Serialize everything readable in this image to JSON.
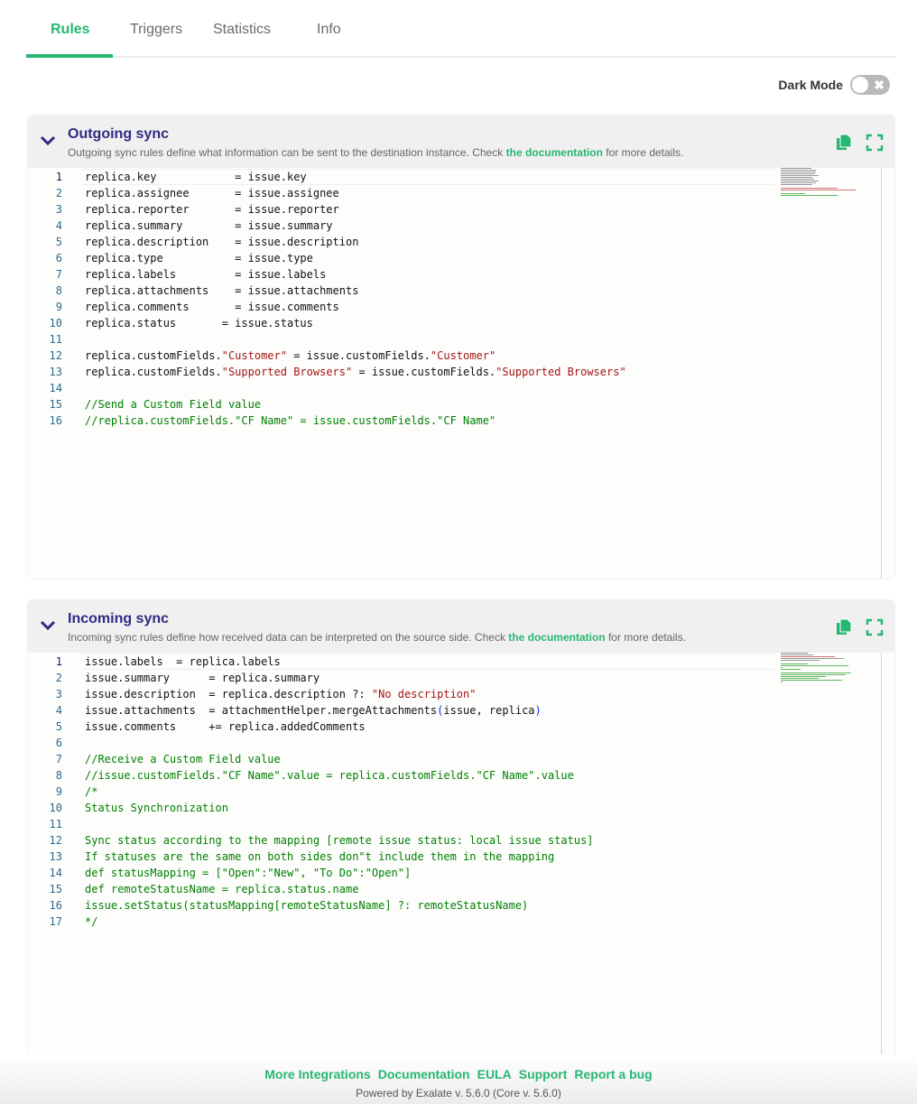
{
  "tabs": [
    {
      "label": "Rules",
      "active": true
    },
    {
      "label": "Triggers",
      "active": false
    },
    {
      "label": "Statistics",
      "active": false
    },
    {
      "label": "Info",
      "active": false
    }
  ],
  "dark_mode": {
    "label": "Dark Mode",
    "enabled": false
  },
  "colors": {
    "accent": "#27b772",
    "title": "#2f2b83",
    "string": "#a31515",
    "comment": "#008000"
  },
  "outgoing": {
    "title": "Outgoing sync",
    "desc_before": "Outgoing sync rules define what information can be sent to the destination instance. Check ",
    "desc_link": "the documentation",
    "desc_after": " for more details.",
    "lines": [
      "replica.key            = issue.key",
      "replica.assignee       = issue.assignee",
      "replica.reporter       = issue.reporter",
      "replica.summary        = issue.summary",
      "replica.description    = issue.description",
      "replica.type           = issue.type",
      "replica.labels         = issue.labels",
      "replica.attachments    = issue.attachments",
      "replica.comments       = issue.comments",
      "replica.status       = issue.status",
      "",
      "replica.customFields.\"Customer\" = issue.customFields.\"Customer\"",
      "replica.customFields.\"Supported Browsers\" = issue.customFields.\"Supported Browsers\"",
      "",
      "//Send a Custom Field value",
      "//replica.customFields.\"CF Name\" = issue.customFields.\"CF Name\""
    ]
  },
  "incoming": {
    "title": "Incoming sync",
    "desc_before": "Incoming sync rules define how received data can be interpreted on the source side. Check ",
    "desc_link": "the documentation",
    "desc_after": " for more details.",
    "lines": [
      "issue.labels  = replica.labels",
      "issue.summary      = replica.summary",
      "issue.description  = replica.description ?: \"No description\"",
      "issue.attachments  = attachmentHelper.mergeAttachments(issue, replica)",
      "issue.comments     += replica.addedComments",
      "",
      "//Receive a Custom Field value",
      "//issue.customFields.\"CF Name\".value = replica.customFields.\"CF Name\".value",
      "/*",
      "Status Synchronization",
      "",
      "Sync status according to the mapping [remote issue status: local issue status]",
      "If statuses are the same on both sides don\"t include them in the mapping",
      "def statusMapping = [\"Open\":\"New\", \"To Do\":\"Open\"]",
      "def remoteStatusName = replica.status.name",
      "issue.setStatus(statusMapping[remoteStatusName] ?: remoteStatusName)",
      "*/"
    ],
    "comment_block_start": 7
  },
  "footer": {
    "links": [
      "More Integrations",
      "Documentation",
      "EULA",
      "Support",
      "Report a bug"
    ],
    "powered": "Powered by Exalate v. 5.6.0 (Core v. 5.6.0)"
  }
}
